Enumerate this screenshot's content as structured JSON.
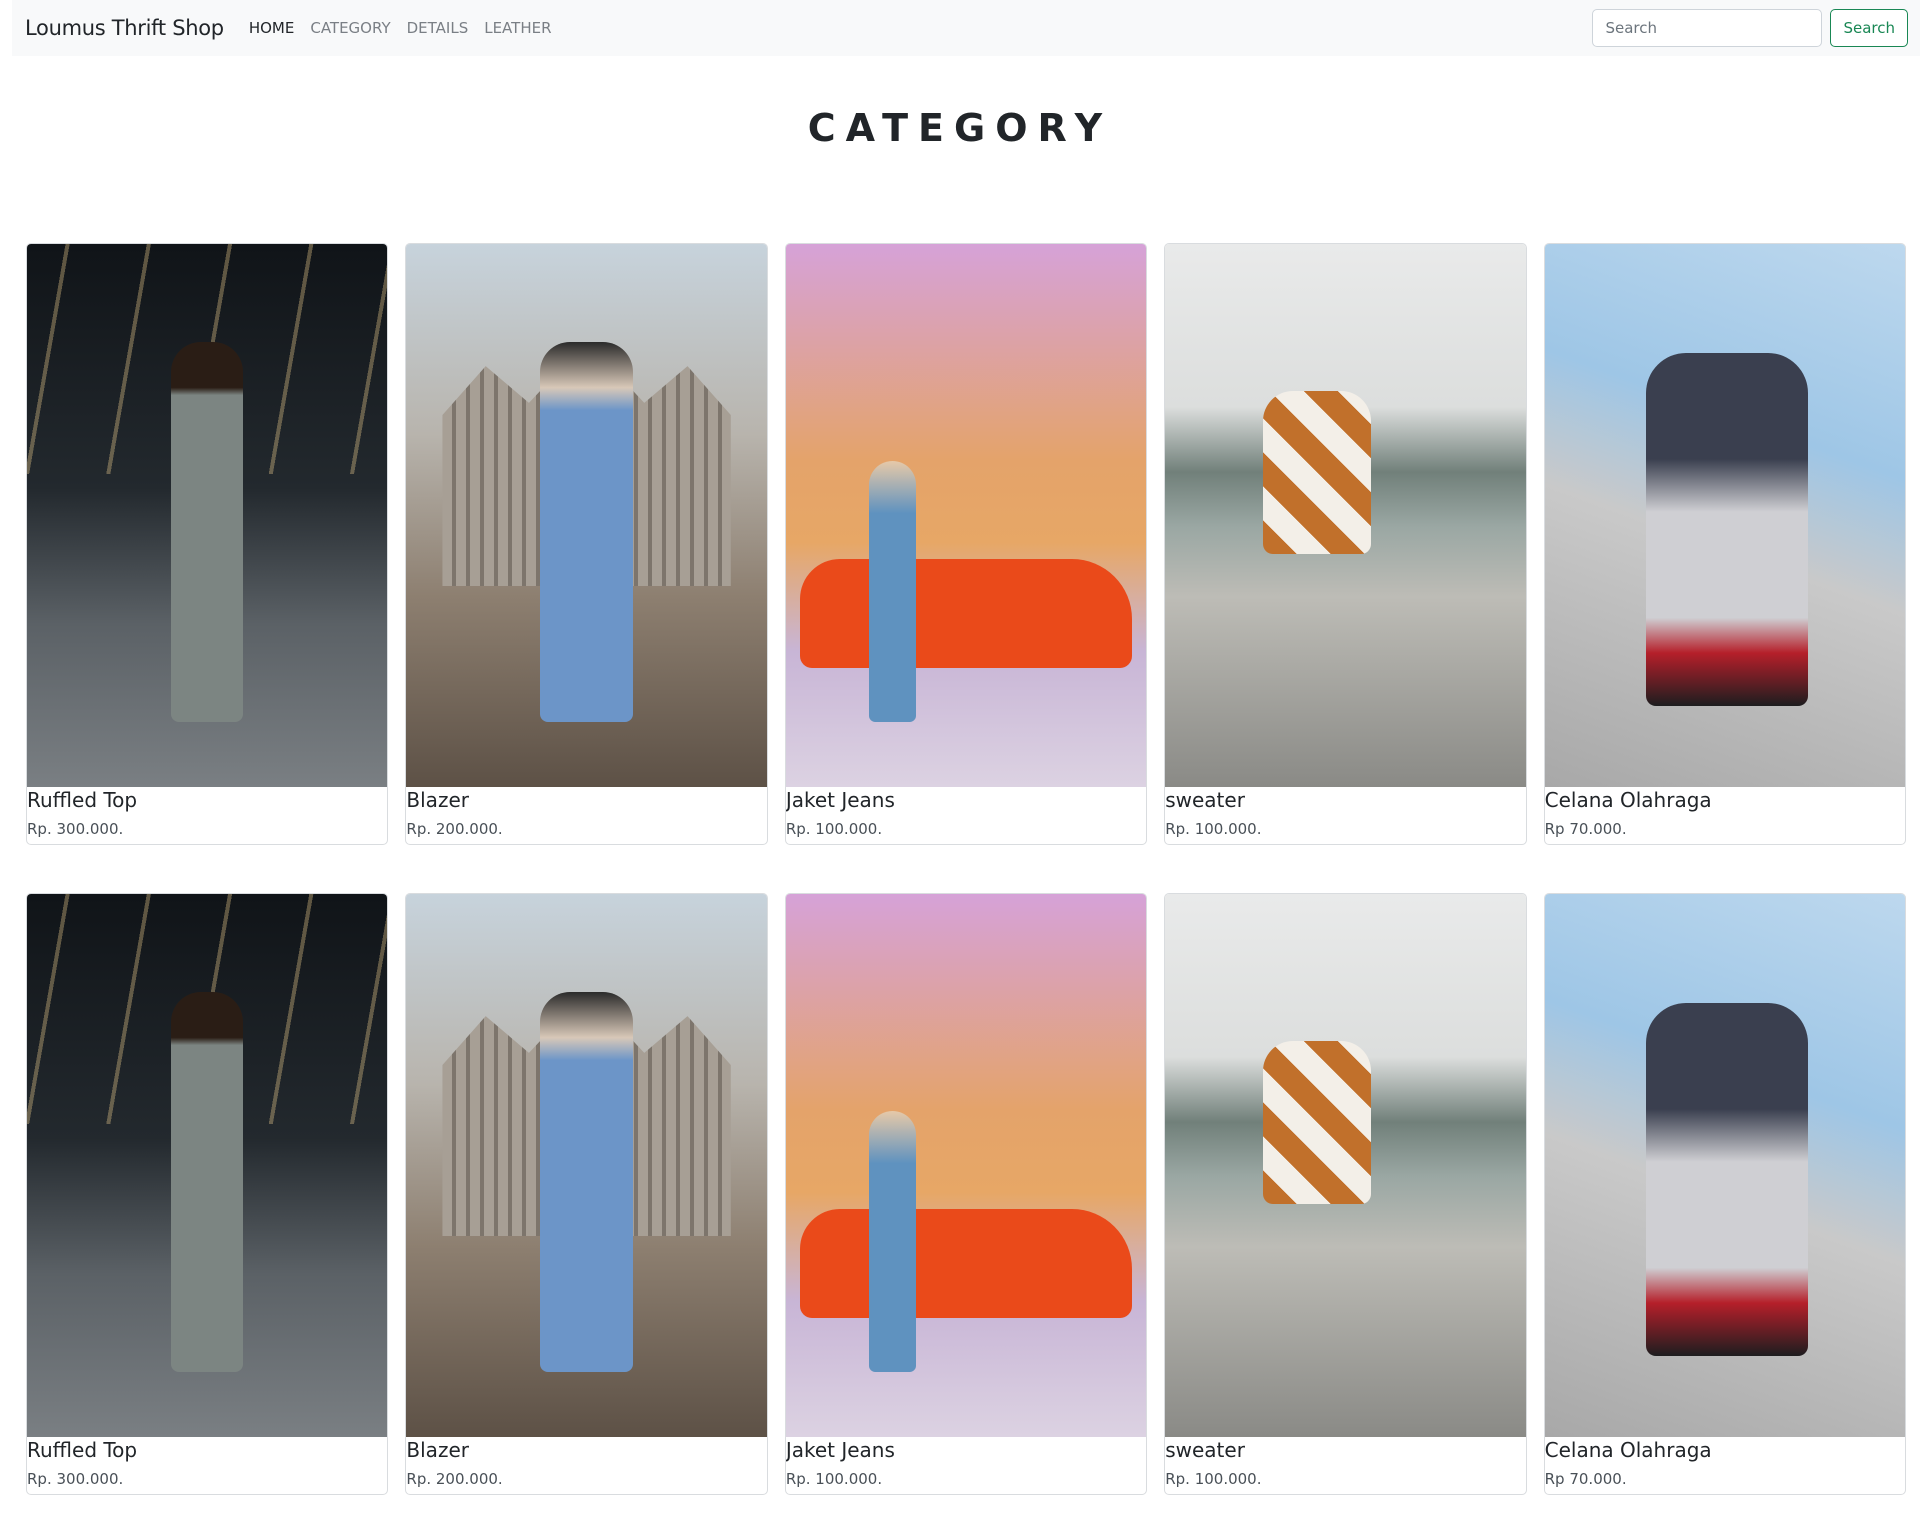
{
  "navbar": {
    "brand": "Loumus Thrift Shop",
    "links": [
      "HOME",
      "CATEGORY",
      "DETAILS",
      "LEATHER"
    ],
    "active_link": "HOME",
    "search_placeholder": "Search",
    "search_button": "Search"
  },
  "page_title": "CATEGORY",
  "rows": [
    {
      "products": [
        {
          "name": "Ruffled Top",
          "price": "Rp. 300.000."
        },
        {
          "name": "Blazer",
          "price": "Rp. 200.000."
        },
        {
          "name": "Jaket Jeans",
          "price": "Rp. 100.000."
        },
        {
          "name": "sweater",
          "price": "Rp. 100.000."
        },
        {
          "name": "Celana Olahraga",
          "price": "Rp 70.000."
        }
      ]
    },
    {
      "products": [
        {
          "name": "Ruffled Top",
          "price": "Rp. 300.000."
        },
        {
          "name": "Blazer",
          "price": "Rp. 200.000."
        },
        {
          "name": "Jaket Jeans",
          "price": "Rp. 100.000."
        },
        {
          "name": "sweater",
          "price": "Rp. 100.000."
        },
        {
          "name": "Celana Olahraga",
          "price": "Rp 70.000."
        }
      ]
    }
  ],
  "colors": {
    "navbar_bg": "#f8f9fa",
    "search_button": "#198754",
    "text": "#212529"
  }
}
